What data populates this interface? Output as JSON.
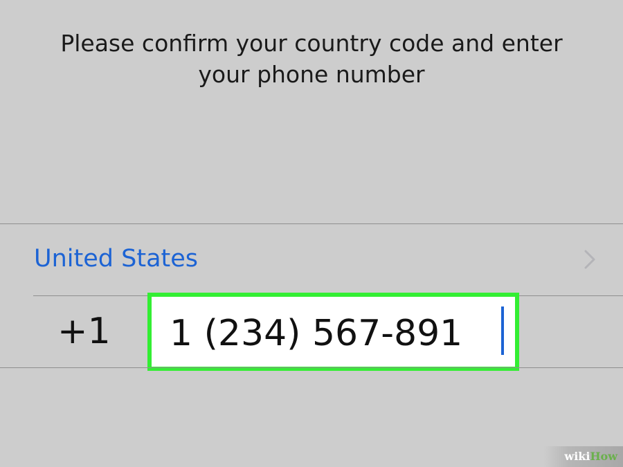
{
  "instruction": {
    "line1": "Please confirm your country code and enter",
    "line2": "your phone number"
  },
  "country": {
    "name": "United States",
    "chevron_icon": "chevron-right-icon"
  },
  "phone": {
    "dial_code": "+1",
    "value": "1 (234) 567-891",
    "highlight_color": "#33ee33"
  },
  "colors": {
    "background": "#cdcdcd",
    "accent": "#1c63d4"
  },
  "watermark": {
    "wiki": "wiki",
    "how": "How"
  }
}
